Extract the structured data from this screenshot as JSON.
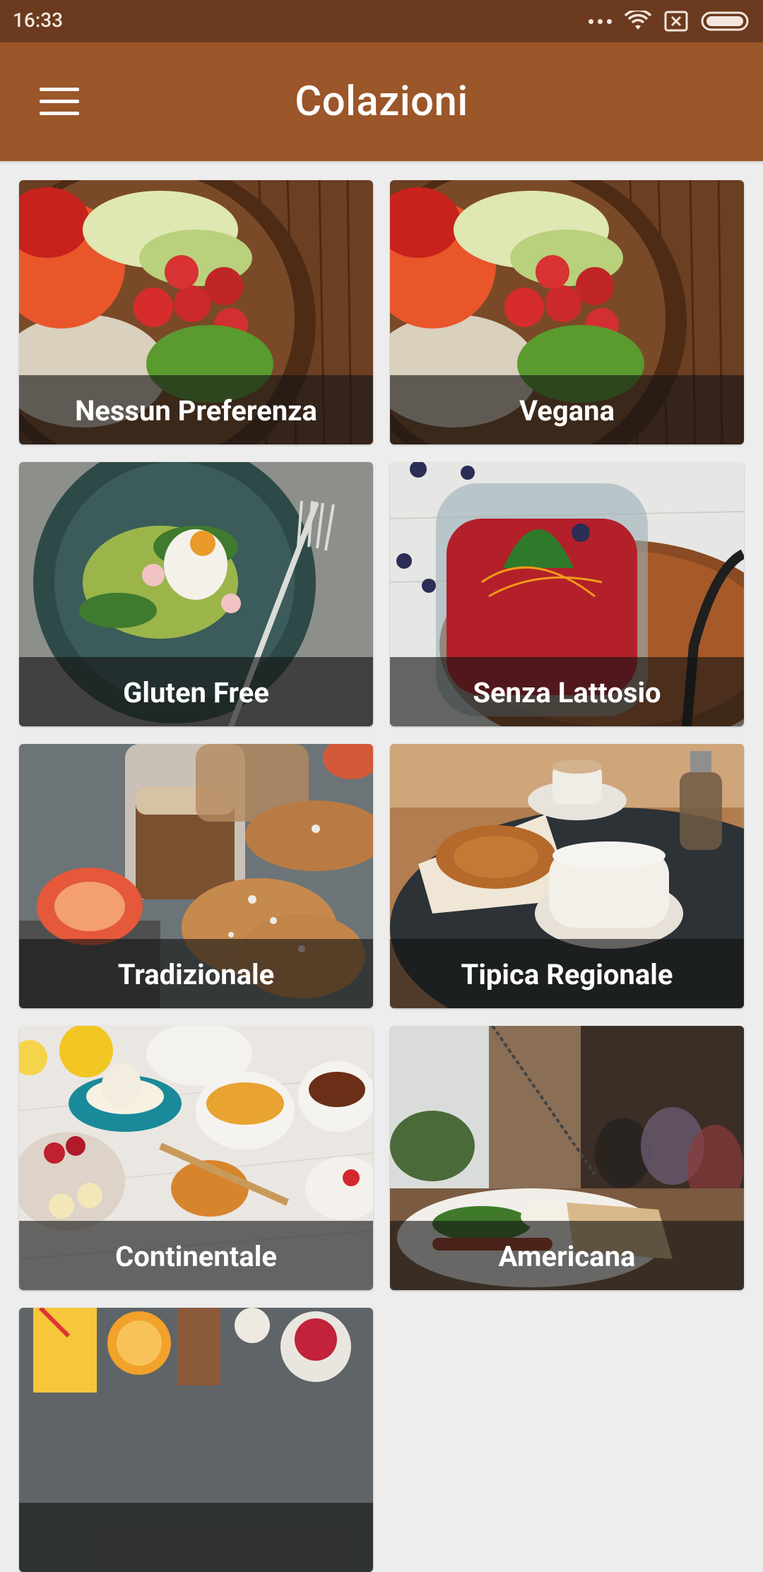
{
  "status_bar": {
    "time": "16:33",
    "icons": [
      "dots-icon",
      "wifi-icon",
      "sim-x-icon",
      "battery-icon"
    ]
  },
  "app_bar": {
    "title": "Colazioni",
    "menu_icon": "hamburger-menu-icon",
    "background": "#9b562a"
  },
  "categories": [
    {
      "label": "Nessun Preferenza",
      "image": "buddha-bowl-photo"
    },
    {
      "label": "Vegana",
      "image": "buddha-bowl-photo"
    },
    {
      "label": "Gluten Free",
      "image": "avocado-egg-plate-photo"
    },
    {
      "label": "Senza Lattosio",
      "image": "berry-smoothie-jar-photo"
    },
    {
      "label": "Tradizionale",
      "image": "coffee-croissants-photo"
    },
    {
      "label": "Tipica Regionale",
      "image": "cappuccino-croissant-photo"
    },
    {
      "label": "Continentale",
      "image": "continental-breakfast-table-photo"
    },
    {
      "label": "Americana",
      "image": "american-breakfast-cafe-photo"
    },
    {
      "label": "",
      "image": "juice-fruit-photo"
    }
  ],
  "colors": {
    "status_bar": "#6b3a1f",
    "app_bar": "#9b562a",
    "page_background": "#ededed",
    "label_band": "rgba(20,20,20,0.62)"
  }
}
